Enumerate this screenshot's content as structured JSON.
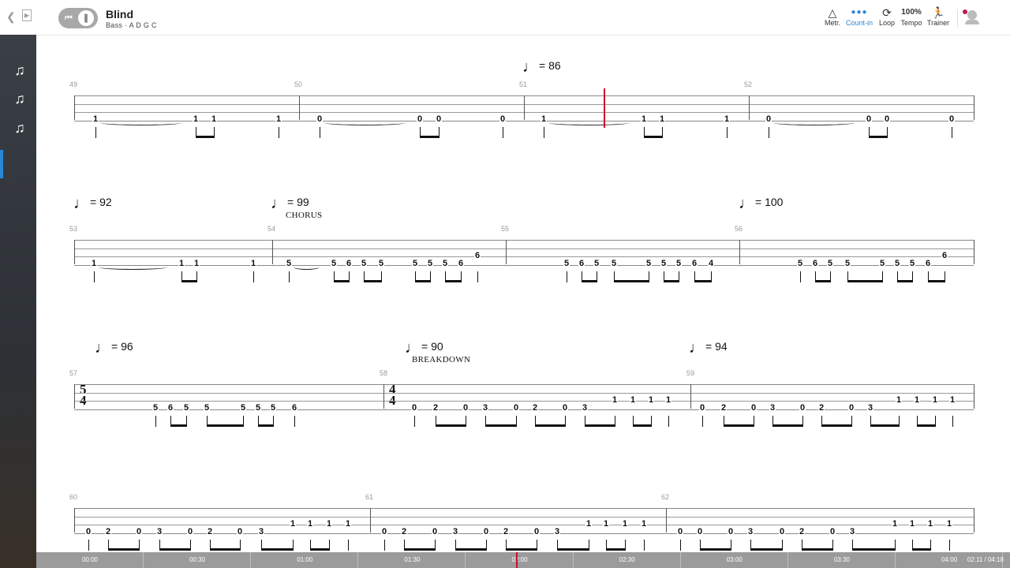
{
  "header": {
    "title": "Blind",
    "instrument": "Bass",
    "tuning": "A D G C"
  },
  "tools": [
    {
      "label": "Metr.",
      "icon": "metronome-icon",
      "active": false
    },
    {
      "label": "Count-in",
      "icon": "count-in-icon",
      "active": true
    },
    {
      "label": "Loop",
      "icon": "loop-icon",
      "active": false
    },
    {
      "label": "Tempo",
      "value": "100%",
      "active": false
    },
    {
      "label": "Trainer",
      "icon": "trainer-icon",
      "active": false
    }
  ],
  "sidebar": {
    "items": [
      "bass-guitar-icon",
      "bass-guitar-icon",
      "bass-guitar-icon"
    ],
    "active_index": 2
  },
  "score": {
    "tempos": [
      "= 86",
      "= 92",
      "= 99",
      "= 100",
      "= 96",
      "= 90",
      "= 94"
    ],
    "sections": [
      "CHORUS",
      "BREAKDOWN"
    ],
    "bars": [
      "49",
      "50",
      "51",
      "52",
      "53",
      "54",
      "55",
      "56",
      "57",
      "58",
      "59",
      "60",
      "61",
      "62"
    ],
    "time_signatures": [
      {
        "top": "5",
        "bottom": "4"
      },
      {
        "top": "4",
        "bottom": "4"
      }
    ],
    "systems": [
      {
        "measures": [
          [
            "1",
            "1",
            "1",
            "1"
          ],
          [
            "0",
            "0",
            "0",
            "0"
          ],
          [
            "1",
            "1",
            "1",
            "1"
          ],
          [
            "0",
            "0",
            "0",
            "0"
          ]
        ]
      },
      {
        "measures": [
          [
            "1",
            "1",
            "1",
            "1"
          ],
          [
            "5",
            "5",
            "6",
            "5",
            "5",
            "5",
            "5",
            "5",
            "6",
            "6"
          ],
          [
            "5",
            "6",
            "5",
            "5",
            "5",
            "5",
            "5",
            "6",
            "4"
          ],
          [
            "5",
            "6",
            "5",
            "5",
            "5",
            "5",
            "5",
            "6",
            "6"
          ]
        ]
      },
      {
        "measures": [
          [
            "5",
            "6",
            "5",
            "5",
            "5",
            "5",
            "5",
            "6"
          ],
          [
            "0",
            "2",
            "0",
            "3",
            "0",
            "2",
            "0",
            "3",
            "1",
            "1",
            "1",
            "1"
          ],
          [
            "0",
            "2",
            "0",
            "3",
            "0",
            "2",
            "0",
            "3",
            "1",
            "1",
            "1",
            "1"
          ]
        ]
      },
      {
        "measures": [
          [
            "0",
            "2",
            "0",
            "3",
            "0",
            "2",
            "0",
            "3",
            "1",
            "1",
            "1",
            "1"
          ],
          [
            "0",
            "2",
            "0",
            "3",
            "0",
            "2",
            "0",
            "3",
            "1",
            "1",
            "1",
            "1"
          ],
          [
            "0",
            "0",
            "0",
            "3",
            "0",
            "2",
            "0",
            "3",
            "1",
            "1",
            "1",
            "1"
          ]
        ]
      }
    ]
  },
  "timeline": {
    "labels": [
      "00:00",
      "00:30",
      "01:00",
      "01:30",
      "02:00",
      "02:30",
      "03:00",
      "03:30",
      "04:00"
    ],
    "current": "02:11 / 04:18",
    "progress": 0.51
  }
}
